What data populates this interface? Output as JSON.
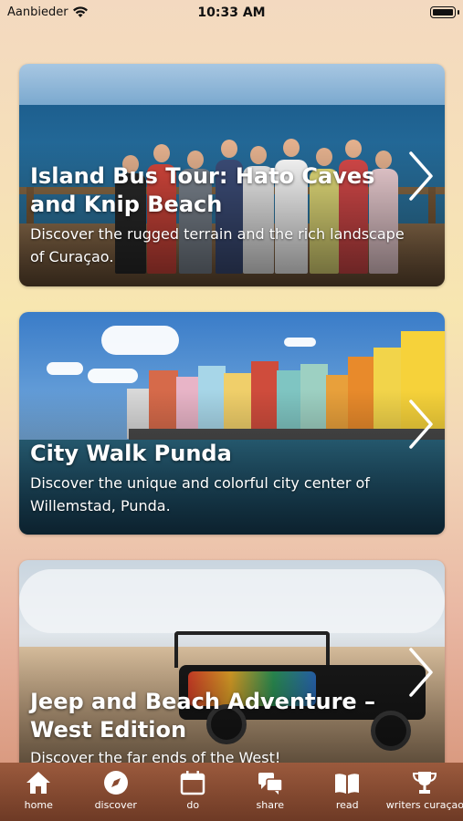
{
  "status": {
    "carrier": "Aanbieder",
    "time": "10:33 AM"
  },
  "cards": [
    {
      "title": "Island Bus Tour: Hato Caves and Knip Beach",
      "description": "Discover the rugged terrain and the rich landscape of Curaçao."
    },
    {
      "title": "City Walk Punda",
      "description": "Discover the unique and colorful city center of Willemstad, Punda."
    },
    {
      "title": "Jeep and Beach Adventure – West Edition",
      "description": "Discover the far ends of the West!"
    }
  ],
  "tabs": [
    {
      "label": "home",
      "icon": "home-icon"
    },
    {
      "label": "discover",
      "icon": "compass-icon"
    },
    {
      "label": "do",
      "icon": "calendar-icon"
    },
    {
      "label": "share",
      "icon": "chat-bubbles-icon"
    },
    {
      "label": "read",
      "icon": "book-icon"
    },
    {
      "label": "writers curaçao",
      "icon": "trophy-icon"
    }
  ]
}
